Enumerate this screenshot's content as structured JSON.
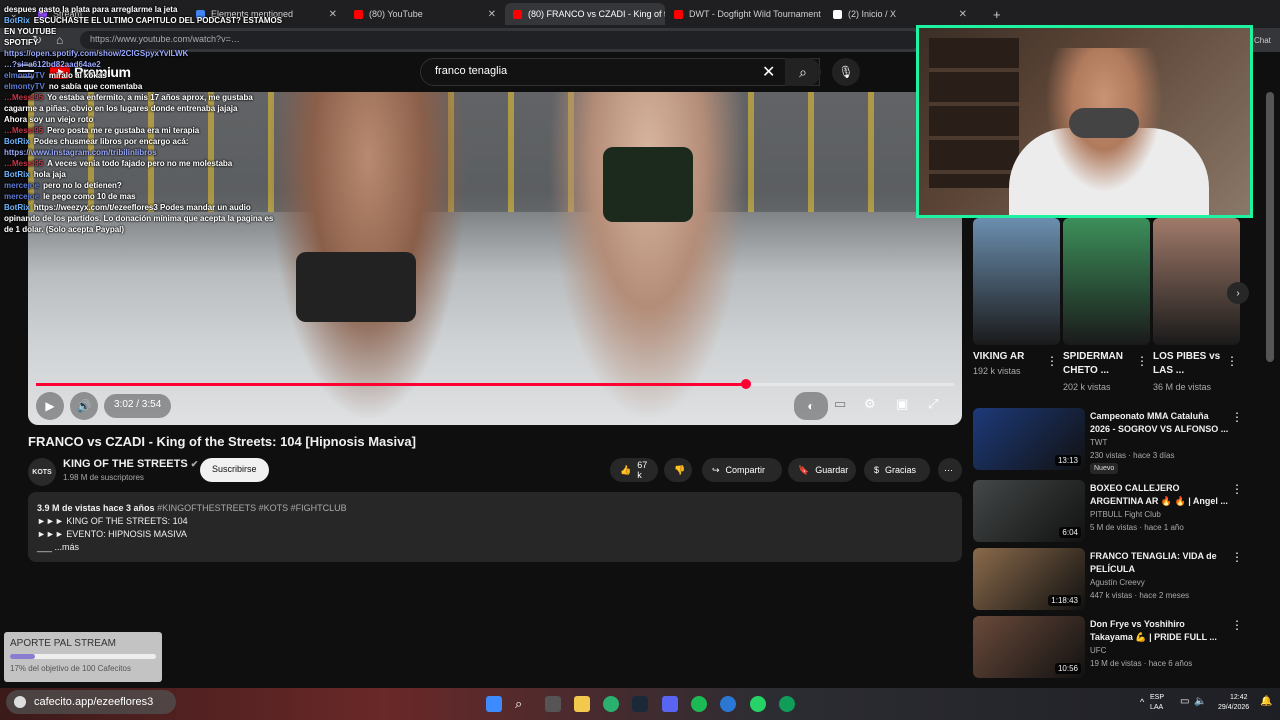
{
  "browser": {
    "tabs": [
      {
        "label": "Stream",
        "color": "#9146ff"
      },
      {
        "label": "Elements mentioned",
        "color": "#4285f4"
      },
      {
        "label": "(80) YouTube",
        "color": "#ff0000"
      },
      {
        "label": "(80) FRANCO vs CZADI - King of th",
        "color": "#ff0000"
      },
      {
        "label": "DWT - Dogfight Wild Tournament",
        "color": "#ff0000"
      },
      {
        "label": "(2) Inicio / X",
        "color": "#ffffff"
      }
    ],
    "url": "https://www.youtube.com/watch?v=…",
    "chat_label": "Chat"
  },
  "header": {
    "logo_text": "Premium",
    "search_query": "franco tenaglia"
  },
  "video": {
    "time": "3:02 / 3:54",
    "progress": 0.7733,
    "title": "FRANCO vs CZADI - King of the Streets: 104 [Hipnosis Masiva]",
    "channel_logo": "KOTS",
    "channel": "KING OF THE STREETS",
    "subscribers": "1.98 M de suscriptores",
    "subscribe": "Suscribirse",
    "likes": "67 k",
    "share": "Compartir",
    "save": "Guardar",
    "thanks": "Gracias"
  },
  "description": {
    "views": "3.9 M de vistas  hace 3 años",
    "tags": "#KINGOFTHESTREETS #KOTS #FIGHTCLUB",
    "line1": "►►► KING OF THE STREETS: 104",
    "line2": "►►► EVENTO: HIPNOSIS MASIVA",
    "more": "___  ...más"
  },
  "chat": [
    {
      "user": "",
      "text": "despues gasto la plata para arreglarme la jeta",
      "color": "#ffffff"
    },
    {
      "user": "BotRix",
      "text": "ESCUCHASTE EL ULTIMO CAPITULO DEL PODCAST? ESTAMOS EN YOUTUBE",
      "color": "#6fb7ff"
    },
    {
      "user": "",
      "text": "SPOTIFY",
      "color": "#ffffff"
    },
    {
      "user": "",
      "text": "https://open.spotify.com/show/2ClGSpyxYvILWK",
      "color": "#9aa9ff"
    },
    {
      "user": "",
      "text": "…?si=a612bd82aad64ae2",
      "color": "#9aa9ff"
    },
    {
      "user": "elmontyTV",
      "text": "miralo al xokas",
      "color": "#5e7bd6"
    },
    {
      "user": "elmontyTV",
      "text": "no sabía que comentaba",
      "color": "#5e7bd6"
    },
    {
      "user": "…Messi95",
      "text": "Yo estaba enfermito, a mis 17 años aprox, me gustaba cagarme a piñas, obvio en los lugares donde entrenaba jajaja",
      "color": "#c8354a"
    },
    {
      "user": "",
      "text": "Ahora soy un viejo roto",
      "color": "#ffffff"
    },
    {
      "user": "…Messi95",
      "text": "Pero posta me re gustaba era mi terapia",
      "color": "#c8354a"
    },
    {
      "user": "BotRix",
      "text": "Podes chusmear libros por encargo acá:",
      "color": "#6fb7ff"
    },
    {
      "user": "",
      "text": "https://www.instagram.com/tribilinlibros",
      "color": "#9aa9ff"
    },
    {
      "user": "…Messi95",
      "text": "A veces venia todo fajado pero no me molestaba",
      "color": "#c8354a"
    },
    {
      "user": "BotRix",
      "text": "hola jaja",
      "color": "#6fb7ff"
    },
    {
      "user": "mercejoe",
      "text": "pero no lo detienen?",
      "color": "#5e7bd6"
    },
    {
      "user": "mercejoe",
      "text": "le pego como 10 de mas",
      "color": "#5e7bd6"
    },
    {
      "user": "BotRix",
      "text": "https://weezyx.com/t/ezeeflores3 Podes mandar un audio opinando de los partidos. Lo donación mínima que acepta la pagina es de 1 dolar. (Solo acepta Paypal)",
      "color": "#6fb7ff"
    }
  ],
  "shorts": [
    {
      "title": "VIKING AR",
      "views": "192 k vistas",
      "views2": "",
      "color": "#6b8fb0"
    },
    {
      "title": "SPIDERMAN CHETO ...",
      "views": "202 k vistas",
      "views2": "",
      "color": "#3c8f5a"
    },
    {
      "title": "LOS PIBES vs LAS ...",
      "views": "36 M de vistas",
      "views2": "",
      "color": "#a07a6a"
    }
  ],
  "related": [
    {
      "title": "Campeonato MMA Cataluña 2026 - SOGROV VS ALFONSO ...",
      "channel": "TWT",
      "meta": "230 vistas · hace 3 días",
      "duration": "13:13",
      "badge": "Nuevo",
      "color": "#1d3a7a"
    },
    {
      "title": "BOXEO CALLEJERO ARGENTINA AR 🔥 🔥 | Angel ...",
      "channel": "PITBULL Fight Club",
      "meta": "5 M de vistas · hace 1 año",
      "duration": "6:04",
      "badge": "",
      "color": "#444848"
    },
    {
      "title": "FRANCO TENAGLIA: VIDA de PELÍCULA",
      "channel": "Agustín Creevy",
      "meta": "447 k vistas · hace 2 meses",
      "duration": "1:18:43",
      "badge": "",
      "color": "#8a6a4a"
    },
    {
      "title": "Don Frye vs Yoshihiro Takayama 💪 | PRIDE FULL ...",
      "channel": "UFC",
      "meta": "19 M de vistas · hace 6 años",
      "duration": "10:56",
      "badge": "",
      "color": "#6a4a3a"
    }
  ],
  "donation": {
    "title": "APORTE PAL STREAM",
    "progress": 0.17,
    "text": "17% del objetivo de 100 Cafecitos"
  },
  "taskbar": {
    "cafecito": "cafecito.app/ezeeflores3",
    "lang1": "ESP",
    "lang2": "LAA",
    "time": "12:42",
    "date": "29/4/2026"
  }
}
